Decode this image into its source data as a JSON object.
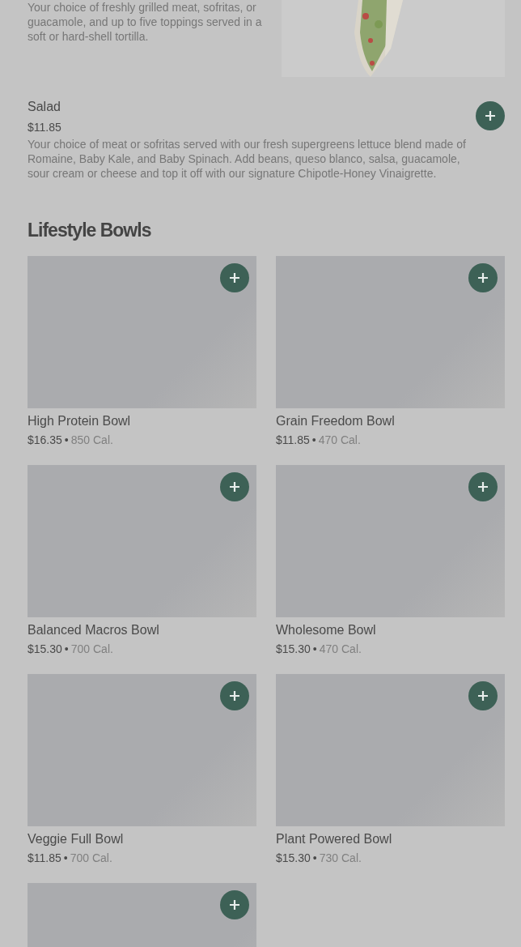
{
  "top_item": {
    "description": "Your choice of freshly grilled meat, sofritas, or guacamole, and up to five toppings served in a soft or hard-shell tortilla."
  },
  "salad": {
    "name": "Salad",
    "price": "$11.85",
    "description": "Your choice of meat or sofritas served with our fresh supergreens lettuce blend made of Romaine, Baby Kale, and Baby Spinach. Add beans, queso blanco, salsa, guacamole, sour cream or cheese and top it off with our signature Chipotle-Honey Vinaigrette."
  },
  "section": {
    "title": "Lifestyle Bowls"
  },
  "bowls": [
    {
      "kind": "item",
      "name": "High Protein Bowl",
      "price": "$16.35",
      "separator": "•",
      "calories": "850 Cal."
    },
    {
      "kind": "item",
      "name": "Grain Freedom Bowl",
      "price": "$11.85",
      "separator": "•",
      "calories": "470 Cal."
    },
    {
      "kind": "item",
      "name": "Balanced Macros Bowl",
      "price": "$15.30",
      "separator": "•",
      "calories": "700 Cal."
    },
    {
      "kind": "item",
      "name": "Wholesome Bowl",
      "price": "$15.30",
      "separator": "•",
      "calories": "470 Cal."
    },
    {
      "kind": "item",
      "name": "Veggie Full Bowl",
      "price": "$11.85",
      "separator": "•",
      "calories": "700 Cal."
    },
    {
      "kind": "item",
      "name": "Plant Powered Bowl",
      "price": "$15.30",
      "separator": "•",
      "calories": "730 Cal."
    },
    {
      "kind": "image_only"
    }
  ]
}
